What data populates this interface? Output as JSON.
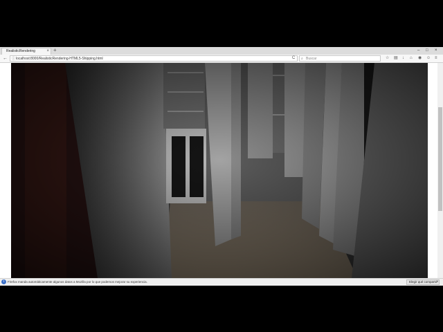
{
  "tab": {
    "title": "RealisticRendering",
    "close": "×",
    "new_tab": "+"
  },
  "window_controls": {
    "minimize": "–",
    "maximize": "□",
    "close": "×"
  },
  "nav": {
    "back": "←",
    "url": "localhost:8000/RealisticRendering-HTML5-Shipping.html",
    "reload": "C"
  },
  "search": {
    "placeholder": "Buscar"
  },
  "toolbar_icons": [
    "star-icon",
    "reading-list-icon",
    "download-icon",
    "home-icon",
    "pocket-icon",
    "chat-icon",
    "menu-icon"
  ],
  "notification": {
    "text": "Firefox manda automáticamente algunos datos a Mozilla por lo que podemos mejorar su experiencia.",
    "button": "Elegir qué comparto",
    "close": "×"
  },
  "colors": {
    "accent": "#3a6fc8",
    "scene_floor": "#a89880"
  }
}
